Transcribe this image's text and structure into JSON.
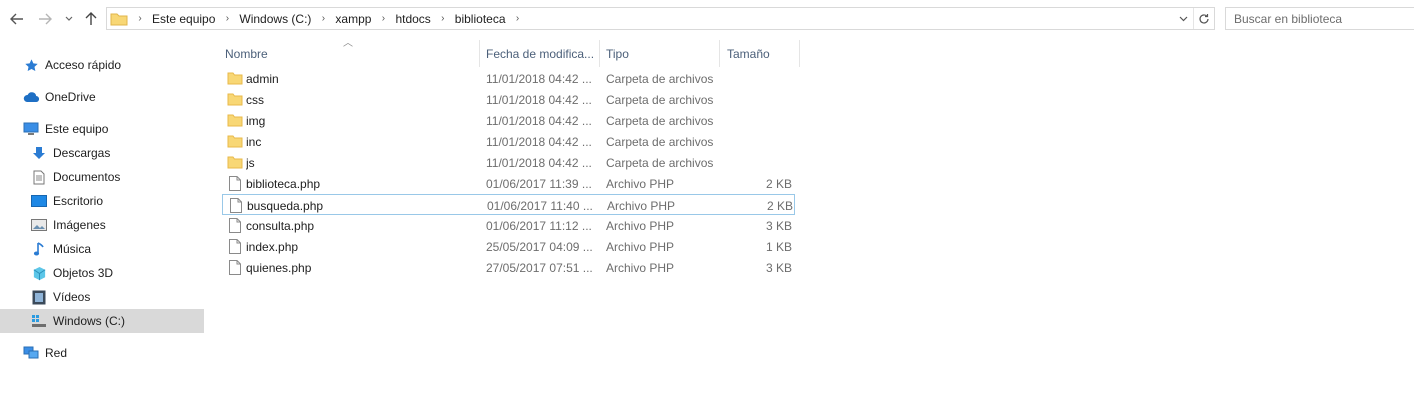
{
  "address_bar": {
    "breadcrumbs": [
      "Este equipo",
      "Windows (C:)",
      "xampp",
      "htdocs",
      "biblioteca"
    ]
  },
  "search": {
    "placeholder": "Buscar en biblioteca"
  },
  "navigation_pane": {
    "items": [
      {
        "label": "Acceso rápido",
        "icon": "star-icon"
      },
      {
        "label": "OneDrive",
        "icon": "cloud-icon"
      },
      {
        "label": "Este equipo",
        "icon": "computer-icon"
      },
      {
        "label": "Descargas",
        "icon": "download-icon"
      },
      {
        "label": "Documentos",
        "icon": "document-icon"
      },
      {
        "label": "Escritorio",
        "icon": "desktop-icon"
      },
      {
        "label": "Imágenes",
        "icon": "pictures-icon"
      },
      {
        "label": "Música",
        "icon": "music-icon"
      },
      {
        "label": "Objetos 3D",
        "icon": "cube-icon"
      },
      {
        "label": "Vídeos",
        "icon": "video-icon"
      },
      {
        "label": "Windows (C:)",
        "icon": "drive-icon",
        "selected": true
      },
      {
        "label": "Red",
        "icon": "network-icon"
      }
    ]
  },
  "file_list": {
    "columns": {
      "name": "Nombre",
      "date": "Fecha de modifica...",
      "type": "Tipo",
      "size": "Tamaño"
    },
    "rows": [
      {
        "name": "admin",
        "date": "11/01/2018 04:42 ...",
        "type": "Carpeta de archivos",
        "size": "",
        "kind": "folder"
      },
      {
        "name": "css",
        "date": "11/01/2018 04:42 ...",
        "type": "Carpeta de archivos",
        "size": "",
        "kind": "folder"
      },
      {
        "name": "img",
        "date": "11/01/2018 04:42 ...",
        "type": "Carpeta de archivos",
        "size": "",
        "kind": "folder"
      },
      {
        "name": "inc",
        "date": "11/01/2018 04:42 ...",
        "type": "Carpeta de archivos",
        "size": "",
        "kind": "folder"
      },
      {
        "name": "js",
        "date": "11/01/2018 04:42 ...",
        "type": "Carpeta de archivos",
        "size": "",
        "kind": "folder"
      },
      {
        "name": "biblioteca.php",
        "date": "01/06/2017 11:39 ...",
        "type": "Archivo PHP",
        "size": "2 KB",
        "kind": "file"
      },
      {
        "name": "busqueda.php",
        "date": "01/06/2017 11:40 ...",
        "type": "Archivo PHP",
        "size": "2 KB",
        "kind": "file",
        "focused": true
      },
      {
        "name": "consulta.php",
        "date": "01/06/2017 11:12 ...",
        "type": "Archivo PHP",
        "size": "3 KB",
        "kind": "file"
      },
      {
        "name": "index.php",
        "date": "25/05/2017 04:09 ...",
        "type": "Archivo PHP",
        "size": "1 KB",
        "kind": "file"
      },
      {
        "name": "quienes.php",
        "date": "27/05/2017 07:51 ...",
        "type": "Archivo PHP",
        "size": "3 KB",
        "kind": "file"
      }
    ]
  },
  "colors": {
    "folder": "#f8d775",
    "folder_dark": "#e8b94a",
    "selection": "#d9d9d9",
    "focus_border": "#99c8e8",
    "header_text": "#4c607a",
    "accent_blue": "#1e7fd4"
  }
}
